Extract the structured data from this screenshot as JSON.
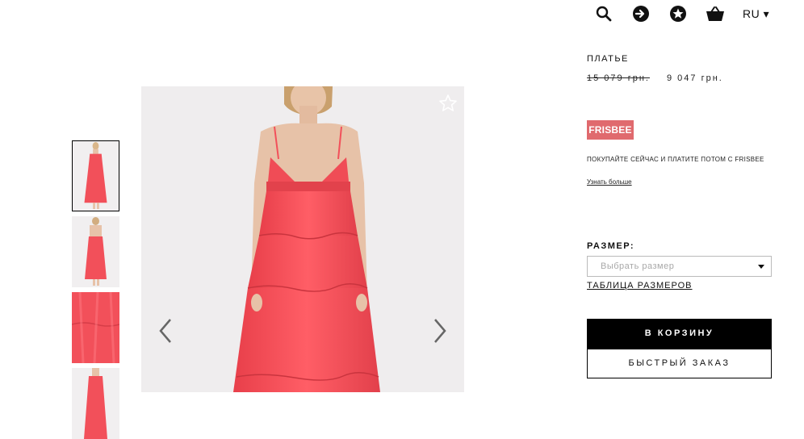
{
  "header": {
    "icons": [
      "search-icon",
      "login-arrow-icon",
      "favorites-star-icon",
      "basket-icon"
    ],
    "language": "RU ▾"
  },
  "gallery": {
    "thumbnails": [
      "front",
      "back",
      "fabric detail",
      "front"
    ],
    "active_thumbnail": 0
  },
  "product": {
    "category": "ПЛАТЬЕ",
    "old_price": "15 079 грн.",
    "new_price": "9 047 грн.",
    "frisbee_badge": "FRISBEE",
    "promo_text": "ПОКУПАЙТЕ СЕЙЧАС И ПЛАТИТЕ ПОТОМ С FRISBEE",
    "learn_more": "Узнать больше",
    "size_label": "РАЗМЕР:",
    "size_placeholder": "Выбрать размер",
    "size_table": "ТАБЛИЦА РАЗМЕРОВ",
    "add_to_cart": "В КОРЗИНУ",
    "quick_order": "БЫСТРЫЙ ЗАКАЗ"
  },
  "colors": {
    "dress": "#f2505a",
    "frisbee_badge": "#e06a6e",
    "cart_button": "#000000"
  }
}
